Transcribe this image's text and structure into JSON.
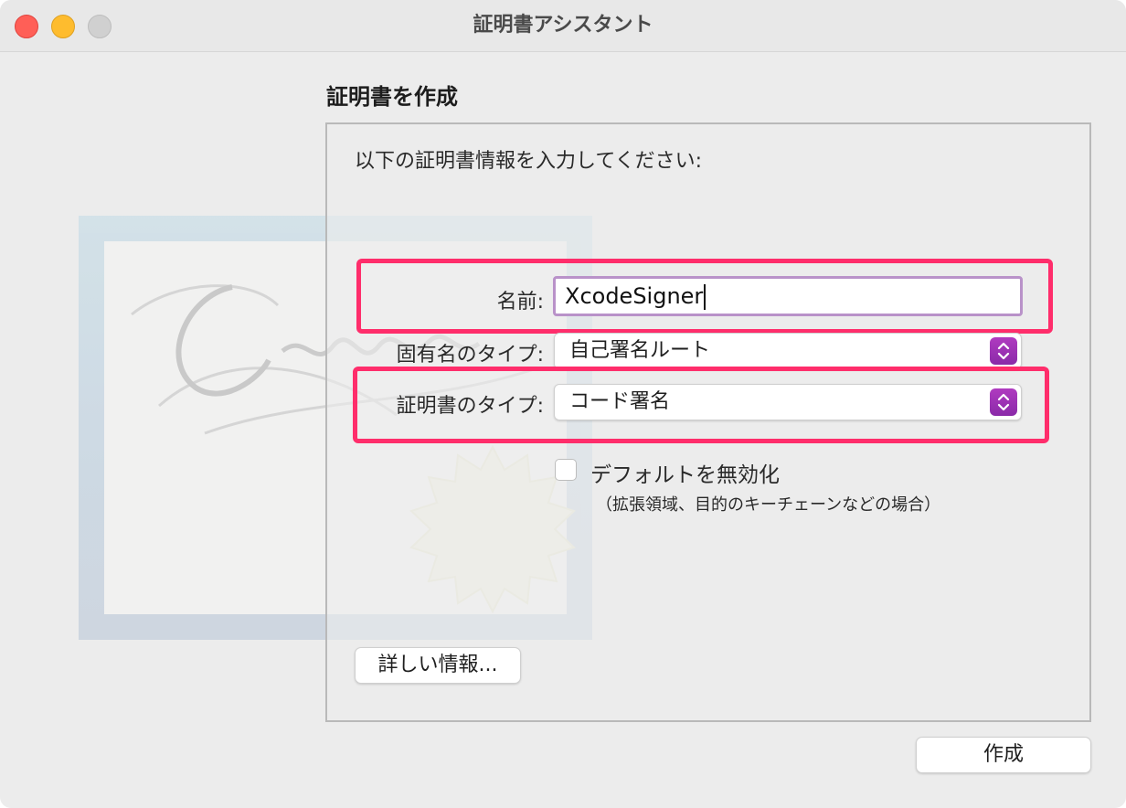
{
  "window": {
    "title": "証明書アシスタント"
  },
  "heading": "証明書を作成",
  "instruction": "以下の証明書情報を入力してください:",
  "form": {
    "name_label": "名前:",
    "name_value": "XcodeSigner",
    "identity_type_label": "固有名のタイプ:",
    "identity_type_value": "自己署名ルート",
    "certificate_type_label": "証明書のタイプ:",
    "certificate_type_value": "コード署名",
    "override_defaults_label": "デフォルトを無効化",
    "override_defaults_note": "（拡張領域、目的のキーチェーンなどの場合）",
    "override_defaults_checked": false
  },
  "buttons": {
    "learn_more": "詳しい情報...",
    "create": "作成"
  },
  "colors": {
    "highlight": "#ff2d6b",
    "popup_accent": "#9b31b4"
  }
}
